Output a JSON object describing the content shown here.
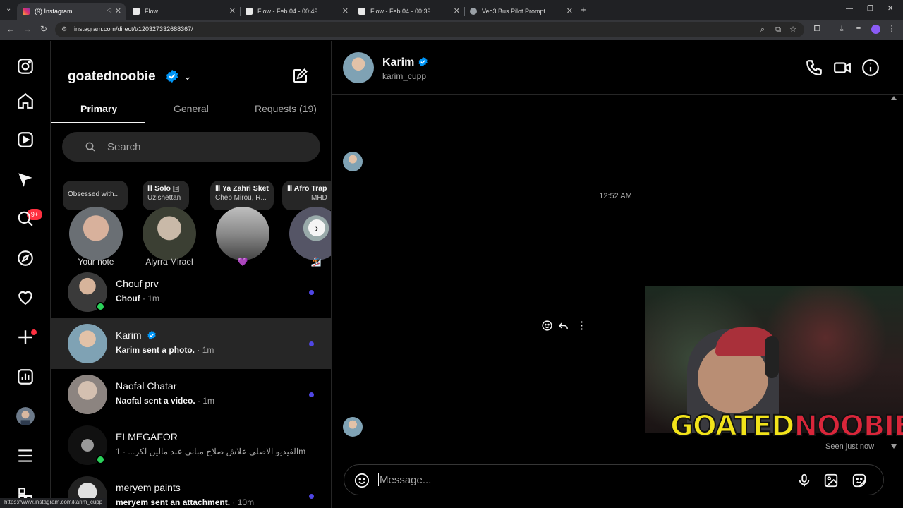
{
  "browser": {
    "tabs": [
      {
        "title": "(9) Instagram"
      },
      {
        "title": "Flow"
      },
      {
        "title": "Flow - Feb 04 - 00:49"
      },
      {
        "title": "Flow - Feb 04 - 00:39"
      },
      {
        "title": "Veo3 Bus Pilot Prompt"
      }
    ],
    "new_tab": "+",
    "url": "instagram.com/direct/t/120327332688367/",
    "status_url": "https://www.instagram.com/karim_cupp"
  },
  "rail": {
    "icons": [
      "instagram-logo-icon",
      "home-icon",
      "reels-icon",
      "messages-icon",
      "search-icon",
      "explore-icon",
      "heart-icon",
      "create-icon",
      "dashboard-icon",
      "profile-icon",
      "menu-icon",
      "more-icon"
    ],
    "messages_badge": "9+"
  },
  "inbox": {
    "username": "goatednoobie",
    "tabs": {
      "primary": "Primary",
      "general": "General",
      "requests": "Requests (19)"
    },
    "search_placeholder": "Search",
    "notes": [
      {
        "text": "Obsessed with...",
        "sub": "",
        "name": "Your note"
      },
      {
        "text": "Solo",
        "sub": "Uzishettan",
        "name": "Alyrra Mirael"
      },
      {
        "text": "Ya Zahri Sket",
        "sub": "Cheb Mirou, R...",
        "name": "💜"
      },
      {
        "text": "Afro Trap",
        "sub": "MHD",
        "name": "🏂"
      }
    ],
    "conversations": [
      {
        "name": "Chouf prv",
        "preview": "Chouf",
        "time": "1m",
        "unread": true,
        "online": true
      },
      {
        "name": "Karim",
        "preview": "Karim sent a photo.",
        "time": "1m",
        "unread": true,
        "online": false
      },
      {
        "name": "Naofal Chatar",
        "preview": "Naofal sent a video.",
        "time": "1m",
        "unread": true,
        "online": false
      },
      {
        "name": "ELMEGAFOR",
        "preview": "الفيديو الاصلي علاش صلاح مباني عند مالين لكر...",
        "time": "1m",
        "unread": false,
        "online": true
      },
      {
        "name": "meryem paints",
        "preview": "meryem sent an attachment.",
        "time": "10m",
        "unread": true,
        "online": false
      }
    ],
    "separator": " · "
  },
  "chat": {
    "name": "Karim",
    "handle": "karim_cupp",
    "timestamp": "12:52 AM",
    "seen": "Seen just now",
    "message_placeholder": "Message..."
  },
  "overlay": {
    "logo_part1": "GOATED",
    "logo_part2": "NOOBIE"
  },
  "colors": {
    "unread_dot": "#4f46e5",
    "badge": "#ff3040",
    "verified": "#0095f6",
    "online": "#2bd15a"
  }
}
